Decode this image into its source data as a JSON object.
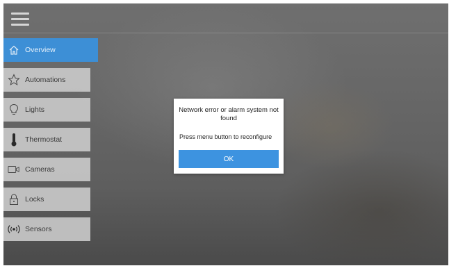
{
  "topbar": {
    "menu_icon": "hamburger-menu-icon"
  },
  "sidebar": {
    "items": [
      {
        "label": "Overview",
        "icon": "home-icon",
        "active": true
      },
      {
        "label": "Automations",
        "icon": "star-icon",
        "active": false
      },
      {
        "label": "Lights",
        "icon": "lightbulb-icon",
        "active": false
      },
      {
        "label": "Thermostat",
        "icon": "thermometer-icon",
        "active": false
      },
      {
        "label": "Cameras",
        "icon": "camera-icon",
        "active": false
      },
      {
        "label": "Locks",
        "icon": "lock-icon",
        "active": false
      },
      {
        "label": "Sensors",
        "icon": "sensor-icon",
        "active": false
      }
    ]
  },
  "dialog": {
    "message": "Network error or alarm system not found",
    "instruction": "Press menu button to reconfigure",
    "ok_label": "OK"
  },
  "colors": {
    "accent": "#3d8fd6",
    "button": "#3d93e0",
    "nav_bg": "#cdcdcd"
  }
}
